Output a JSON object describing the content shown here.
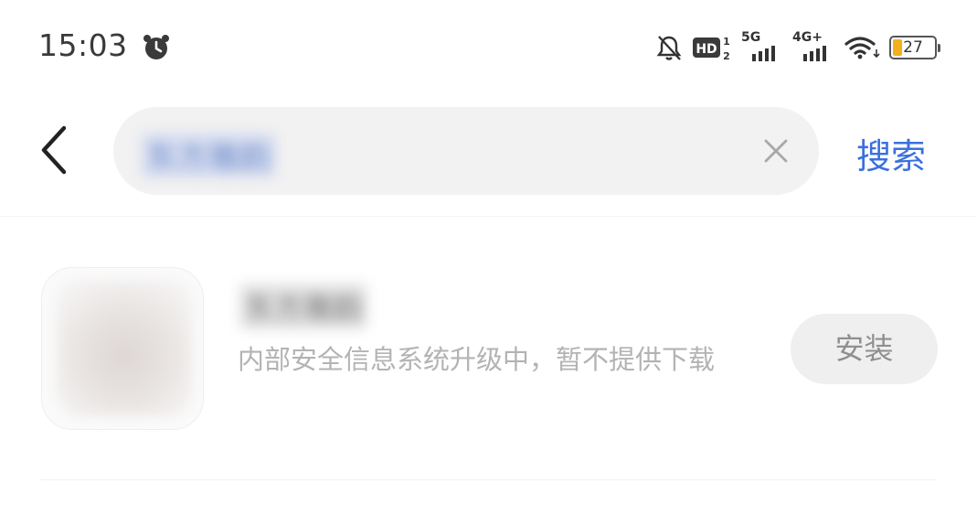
{
  "status_bar": {
    "time": "15:03",
    "battery_level": "27",
    "network_1": "5G",
    "network_2": "4G+",
    "hd_label": "HD",
    "icons": [
      "alarm-icon",
      "bell-off-icon",
      "hd-icon",
      "signal-5g-icon",
      "signal-4g-icon",
      "wifi-icon",
      "battery-icon"
    ]
  },
  "search": {
    "query": "东方雅韵",
    "submit_label": "搜索"
  },
  "results": [
    {
      "name": "东方雅韵",
      "description": "内部安全信息系统升级中，暂不提供下载",
      "action_label": "安装"
    }
  ],
  "colors": {
    "accent": "#3b6fe0",
    "battery": "#f2b01e",
    "muted_text": "#b3b3b3"
  }
}
